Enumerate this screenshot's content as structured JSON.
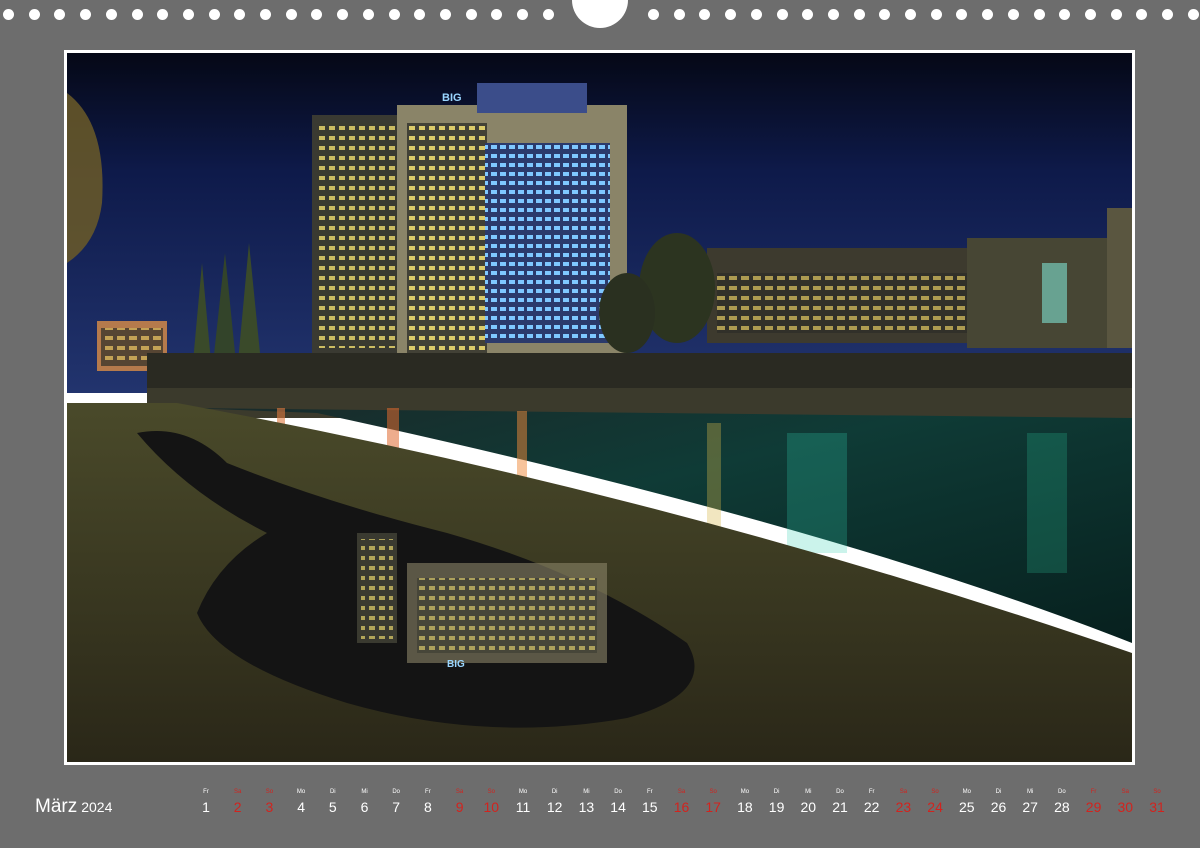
{
  "calendar": {
    "month": "März",
    "year": "2024",
    "days": [
      {
        "wd": "Fr",
        "num": "1",
        "holiday": false
      },
      {
        "wd": "Sa",
        "num": "2",
        "holiday": true
      },
      {
        "wd": "So",
        "num": "3",
        "holiday": true
      },
      {
        "wd": "Mo",
        "num": "4",
        "holiday": false
      },
      {
        "wd": "Di",
        "num": "5",
        "holiday": false
      },
      {
        "wd": "Mi",
        "num": "6",
        "holiday": false
      },
      {
        "wd": "Do",
        "num": "7",
        "holiday": false
      },
      {
        "wd": "Fr",
        "num": "8",
        "holiday": false
      },
      {
        "wd": "Sa",
        "num": "9",
        "holiday": true
      },
      {
        "wd": "So",
        "num": "10",
        "holiday": true
      },
      {
        "wd": "Mo",
        "num": "11",
        "holiday": false
      },
      {
        "wd": "Di",
        "num": "12",
        "holiday": false
      },
      {
        "wd": "Mi",
        "num": "13",
        "holiday": false
      },
      {
        "wd": "Do",
        "num": "14",
        "holiday": false
      },
      {
        "wd": "Fr",
        "num": "15",
        "holiday": false
      },
      {
        "wd": "Sa",
        "num": "16",
        "holiday": true
      },
      {
        "wd": "So",
        "num": "17",
        "holiday": true
      },
      {
        "wd": "Mo",
        "num": "18",
        "holiday": false
      },
      {
        "wd": "Di",
        "num": "19",
        "holiday": false
      },
      {
        "wd": "Mi",
        "num": "20",
        "holiday": false
      },
      {
        "wd": "Do",
        "num": "21",
        "holiday": false
      },
      {
        "wd": "Fr",
        "num": "22",
        "holiday": false
      },
      {
        "wd": "Sa",
        "num": "23",
        "holiday": true
      },
      {
        "wd": "So",
        "num": "24",
        "holiday": true
      },
      {
        "wd": "Mo",
        "num": "25",
        "holiday": false
      },
      {
        "wd": "Di",
        "num": "26",
        "holiday": false
      },
      {
        "wd": "Mi",
        "num": "27",
        "holiday": false
      },
      {
        "wd": "Do",
        "num": "28",
        "holiday": false
      },
      {
        "wd": "Fr",
        "num": "29",
        "holiday": true
      },
      {
        "wd": "Sa",
        "num": "30",
        "holiday": true
      },
      {
        "wd": "So",
        "num": "31",
        "holiday": true
      }
    ]
  },
  "photo": {
    "building_sign": "BIG"
  },
  "colors": {
    "background": "#6d6d6d",
    "holiday": "#d2231e",
    "text": "#ffffff",
    "sky": "#0e1a4a"
  }
}
